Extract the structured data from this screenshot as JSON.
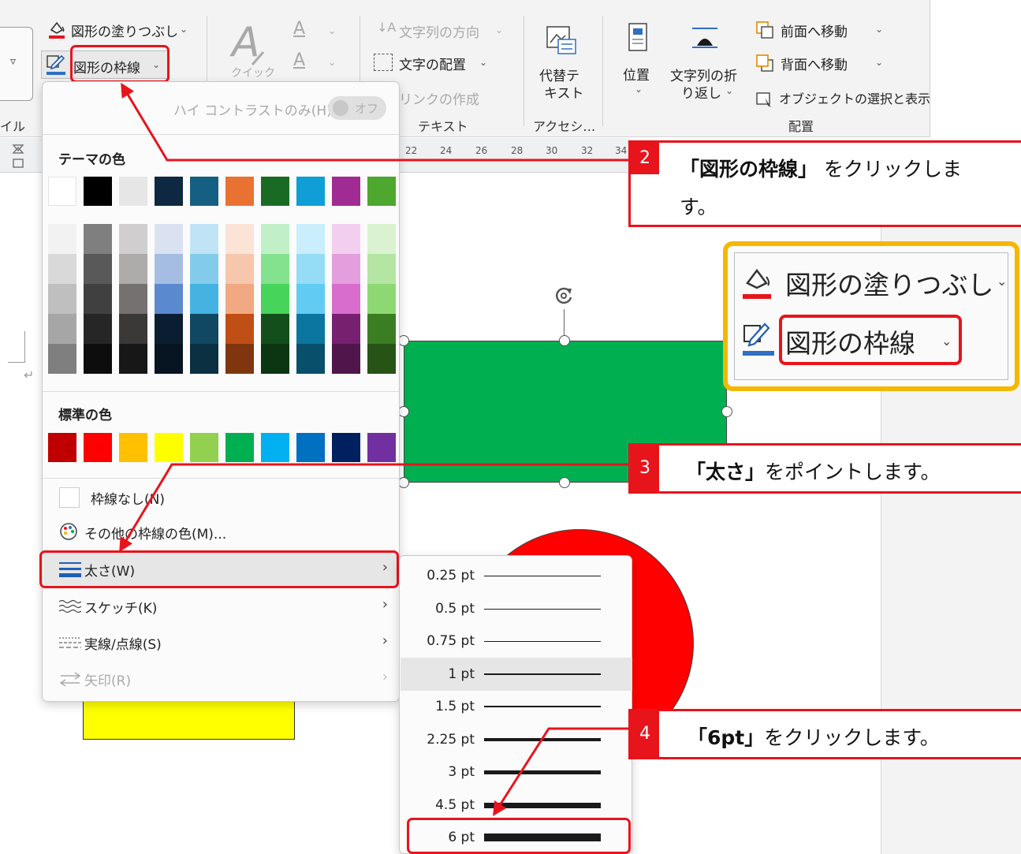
{
  "ribbon": {
    "shape_fill_label": "図形の塗りつぶし",
    "shape_outline_label": "図形の枠線",
    "quick_styles_label": "クイック",
    "text_direction_label": "文字列の方向",
    "align_text_label": "文字の配置",
    "create_link_label": "リンクの作成",
    "text_group_label": "テキスト",
    "alt_text_label_line1": "代替テ",
    "alt_text_label_line2": "キスト",
    "accessibility_group_label": "アクセシ…",
    "position_label": "位置",
    "wrap_text_line1": "文字列の折",
    "wrap_text_line2": "り返し",
    "bring_forward_label": "前面へ移動",
    "send_backward_label": "背面へ移動",
    "selection_pane_label": "オブジェクトの選択と表示",
    "arrange_group_label": "配置",
    "styles_partial_label": "イル",
    "fill_accent_color": "#e8141c",
    "outline_accent_color": "#2f6fc4"
  },
  "ruler": {
    "ticks": [
      "22",
      "24",
      "26",
      "28",
      "30",
      "32",
      "34"
    ]
  },
  "dropdown": {
    "high_contrast_label": "ハイ コントラストのみ(H)",
    "high_contrast_toggle": "オフ",
    "theme_colors_heading": "テーマの色",
    "theme_colors": [
      "#ffffff",
      "#000000",
      "#e7e6e6",
      "#0e2841",
      "#156082",
      "#e97132",
      "#196b24",
      "#0f9ed5",
      "#a02b93",
      "#4ea72e"
    ],
    "theme_shades": [
      [
        "#f2f2f2",
        "#d9d9d9",
        "#bfbfbf",
        "#a6a6a6",
        "#7f7f7f"
      ],
      [
        "#7f7f7f",
        "#595959",
        "#404040",
        "#262626",
        "#0d0d0d"
      ],
      [
        "#d0cece",
        "#aeabab",
        "#757171",
        "#3b3838",
        "#181717"
      ],
      [
        "#dae2f1",
        "#a6bde3",
        "#5b89cf",
        "#0b1e31",
        "#071421"
      ],
      [
        "#c0e4f5",
        "#83cbeb",
        "#44b3e1",
        "#104862",
        "#0a3041"
      ],
      [
        "#fbe3d6",
        "#f6c6ad",
        "#f1a983",
        "#c04f15",
        "#7f350e"
      ],
      [
        "#c1f0c8",
        "#83e28e",
        "#47d45a",
        "#124f1b",
        "#0c3512"
      ],
      [
        "#caeefb",
        "#95dcf7",
        "#61cbf3",
        "#0b76a0",
        "#074f6a"
      ],
      [
        "#f2cfee",
        "#e59edd",
        "#d86dcd",
        "#782070",
        "#50154b"
      ],
      [
        "#daf2d0",
        "#b4e5a2",
        "#8ed873",
        "#3b7d23",
        "#275317"
      ]
    ],
    "standard_colors_heading": "標準の色",
    "standard_colors": [
      "#c00000",
      "#ff0000",
      "#ffc000",
      "#ffff00",
      "#92d050",
      "#00b050",
      "#00b0f0",
      "#0070c0",
      "#002060",
      "#7030a0"
    ],
    "no_outline_label": "枠線なし(N)",
    "more_colors_label": "その他の枠線の色(M)...",
    "weight_label": "太さ(W)",
    "sketched_label": "スケッチ(K)",
    "dashes_label": "実線/点線(S)",
    "arrows_label": "矢印(R)"
  },
  "weights": [
    {
      "label": "0.25 pt",
      "pt": 0.25
    },
    {
      "label": "0.5 pt",
      "pt": 0.5
    },
    {
      "label": "0.75 pt",
      "pt": 0.75
    },
    {
      "label": "1 pt",
      "pt": 1
    },
    {
      "label": "1.5 pt",
      "pt": 1.5
    },
    {
      "label": "2.25 pt",
      "pt": 2.25
    },
    {
      "label": "3 pt",
      "pt": 3
    },
    {
      "label": "4.5 pt",
      "pt": 4.5
    },
    {
      "label": "6 pt",
      "pt": 6
    }
  ],
  "callouts": {
    "step2_number": "2",
    "step2_bold": "「図形の枠線」",
    "step2_text": " をクリックしま",
    "step2_text2": "す。",
    "step3_number": "3",
    "step3_bold": "「太さ」",
    "step3_text": "をポイントします。",
    "step4_number": "4",
    "step4_bold": "「6pt」",
    "step4_text": "をクリックします。"
  },
  "zoom": {
    "fill_label": "図形の塗りつぶし",
    "outline_label": "図形の枠線"
  },
  "shapes": {
    "rectangle_color": "#00b050",
    "circle_color": "#ff0000",
    "yellow_color": "#ffff00"
  }
}
